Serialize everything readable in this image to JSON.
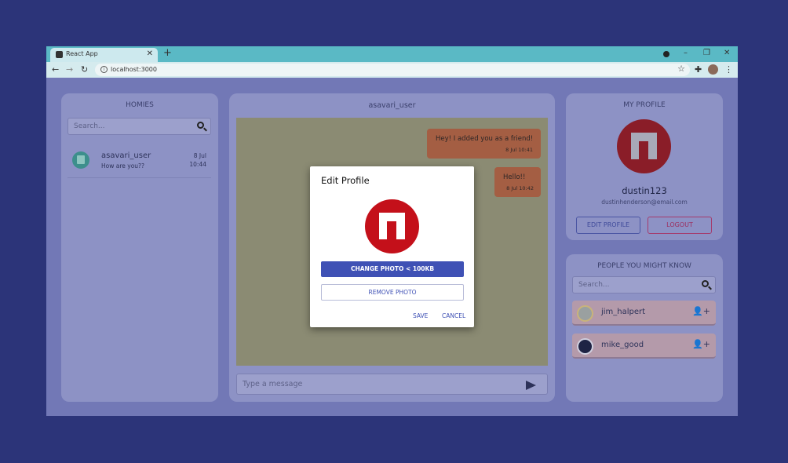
{
  "browser": {
    "tab_title": "React App",
    "url": "localhost:3000"
  },
  "left_panel": {
    "title": "HOMIES",
    "search_placeholder": "Search...",
    "chats": [
      {
        "name": "asavari_user",
        "last_message": "How are you??",
        "date": "8 Jul",
        "time": "10:44"
      }
    ]
  },
  "center_panel": {
    "title": "asavari_user",
    "messages": [
      {
        "text": "Hey! I added you as a friend!",
        "time": "8 Jul 10:41"
      },
      {
        "text": "Hello!!",
        "time": "8 Jul 10:42"
      }
    ],
    "input_placeholder": "Type a message"
  },
  "profile": {
    "title": "MY PROFILE",
    "username": "dustin123",
    "email": "dustinhenderson@email.com",
    "edit_label": "EDIT PROFILE",
    "logout_label": "LOGOUT"
  },
  "pymk": {
    "title": "PEOPLE YOU MIGHT KNOW",
    "search_placeholder": "Search...",
    "people": [
      {
        "name": "jim_halpert"
      },
      {
        "name": "mike_good"
      }
    ]
  },
  "modal": {
    "title": "Edit Profile",
    "change_photo_label": "CHANGE PHOTO < 100KB",
    "remove_photo_label": "REMOVE PHOTO",
    "save_label": "SAVE",
    "cancel_label": "CANCEL"
  },
  "colors": {
    "background": "#2c3479",
    "primary": "#3f51b5",
    "logo_red": "#c4101a",
    "logout": "#c2185b"
  }
}
